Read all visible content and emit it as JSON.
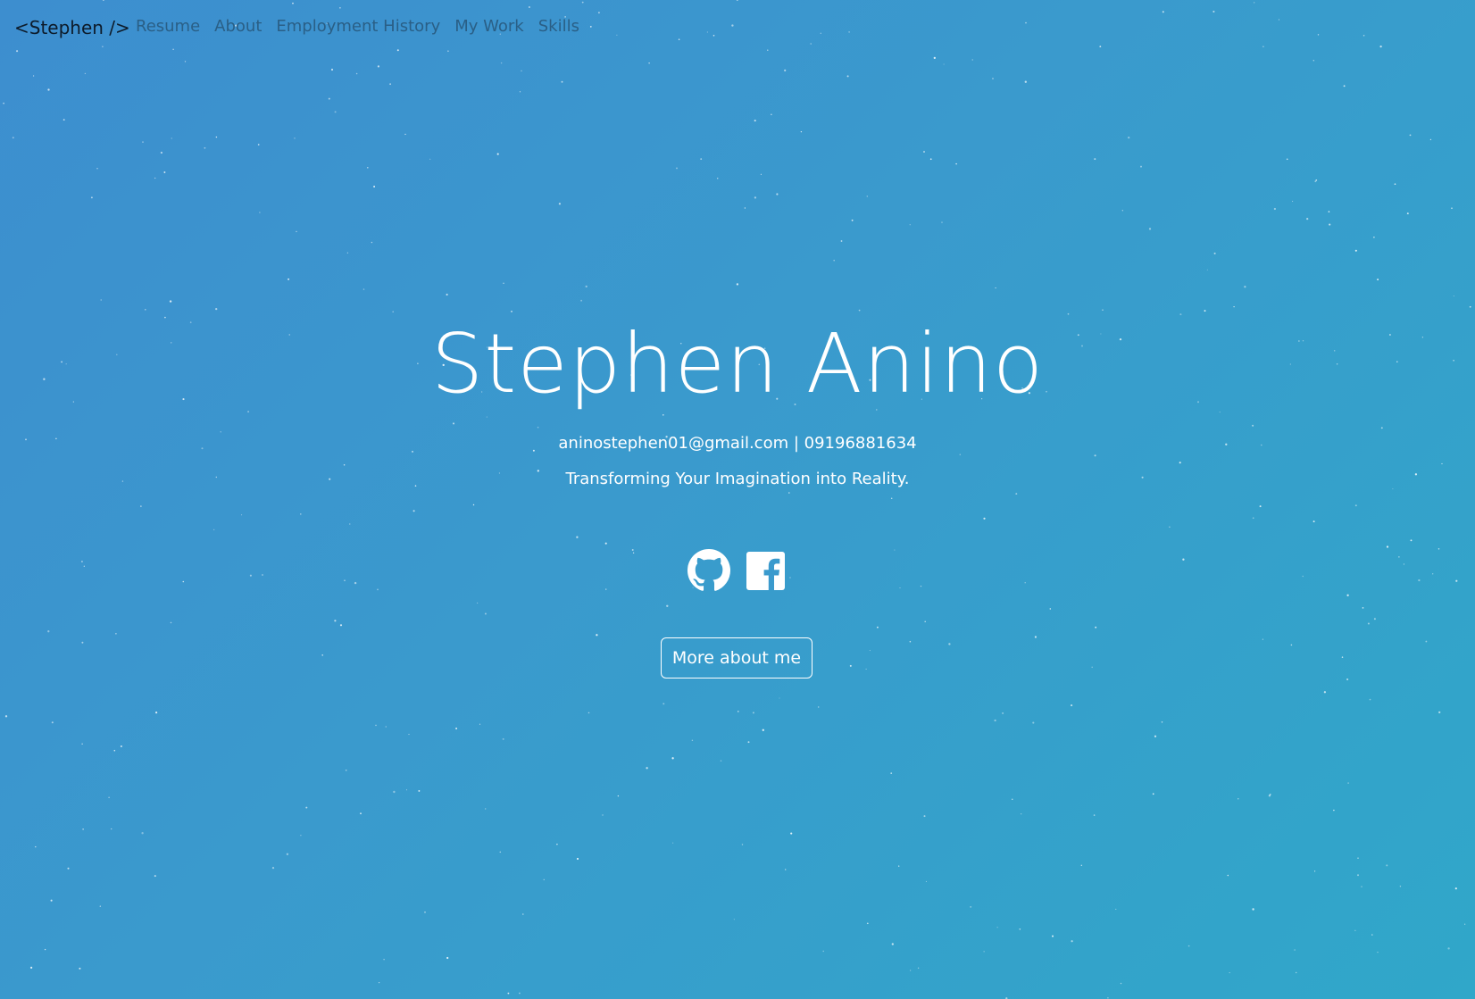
{
  "navbar": {
    "brand": "<Stephen />",
    "links": [
      {
        "label": "Resume"
      },
      {
        "label": "About"
      },
      {
        "label": "Employment History"
      },
      {
        "label": "My Work"
      },
      {
        "label": "Skills"
      }
    ]
  },
  "hero": {
    "name": "Stephen Anino",
    "contact": "aninostephen01@gmail.com | 09196881634",
    "tagline": "Transforming Your Imagination into Reality.",
    "socials": [
      {
        "icon": "github-icon"
      },
      {
        "icon": "facebook-icon"
      }
    ],
    "cta_label": "More about me"
  },
  "colors": {
    "background_start": "#3d8ecf",
    "background_end": "#30a7c9",
    "brand_text": "#0d1b2a",
    "nav_link": "#2a5f86",
    "hero_text": "#ffffff"
  }
}
